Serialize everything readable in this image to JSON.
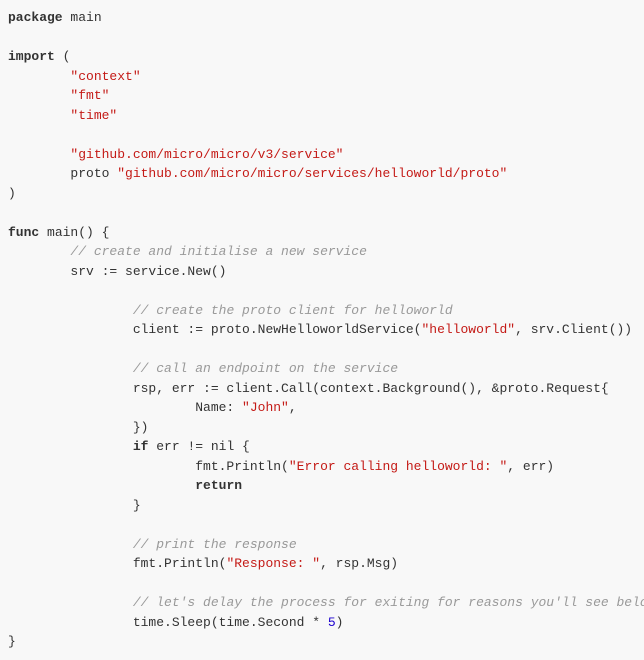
{
  "code": {
    "l1a": "package",
    "l1b": " main",
    "l3a": "import",
    "l3b": " (",
    "l4": "        ",
    "l4s": "\"context\"",
    "l5": "        ",
    "l5s": "\"fmt\"",
    "l6": "        ",
    "l6s": "\"time\"",
    "l8": "        ",
    "l8s": "\"github.com/micro/micro/v3/service\"",
    "l9a": "        proto ",
    "l9s": "\"github.com/micro/micro/services/helloworld/proto\"",
    "l10": ")",
    "l12a": "func",
    "l12b": " main() {",
    "l13": "        ",
    "l13c": "// create and initialise a new service",
    "l14": "        srv := service.New()",
    "l16": "                ",
    "l16c": "// create the proto client for helloworld",
    "l17a": "                client := proto.NewHelloworldService(",
    "l17s": "\"helloworld\"",
    "l17b": ", srv.Client())",
    "l19": "                ",
    "l19c": "// call an endpoint on the service",
    "l20": "                rsp, err := client.Call(context.Background(), &proto.Request{",
    "l21a": "                        Name: ",
    "l21s": "\"John\"",
    "l21b": ",",
    "l22": "                })",
    "l23a": "                ",
    "l23k": "if",
    "l23b": " err != nil {",
    "l24a": "                        fmt.Println(",
    "l24s": "\"Error calling helloworld: \"",
    "l24b": ", err)",
    "l25a": "                        ",
    "l25k": "return",
    "l26": "                }",
    "l28": "                ",
    "l28c": "// print the response",
    "l29a": "                fmt.Println(",
    "l29s": "\"Response: \"",
    "l29b": ", rsp.Msg)",
    "l31": "                ",
    "l31c": "// let's delay the process for exiting for reasons you'll see below",
    "l32a": "                time.Sleep(time.Second * ",
    "l32n": "5",
    "l32b": ")",
    "l33": "}"
  }
}
